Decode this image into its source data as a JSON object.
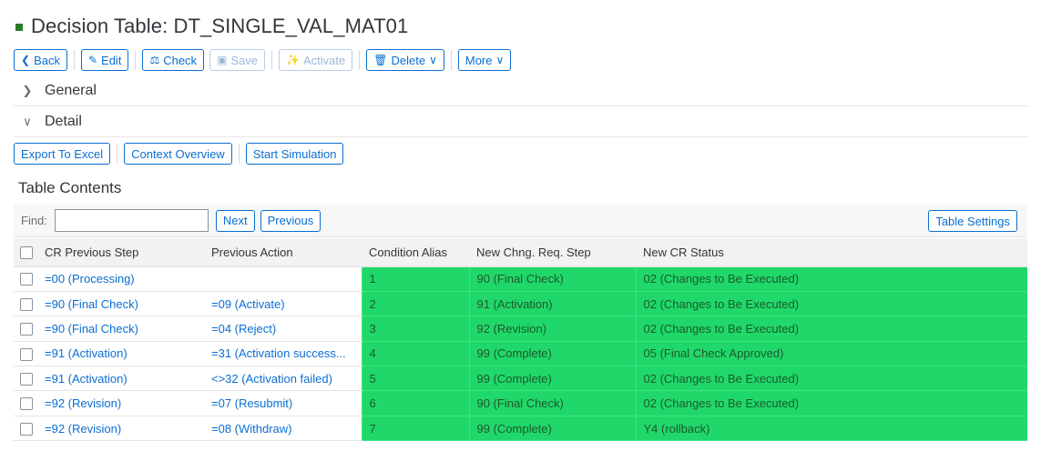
{
  "title": "Decision Table: DT_SINGLE_VAL_MAT01",
  "toolbar": {
    "back": "Back",
    "edit": "Edit",
    "check": "Check",
    "save": "Save",
    "activate": "Activate",
    "delete": "Delete",
    "more": "More"
  },
  "panels": {
    "general": "General",
    "detail": "Detail"
  },
  "actions": {
    "export": "Export To Excel",
    "context": "Context Overview",
    "simulation": "Start Simulation"
  },
  "table_title": "Table Contents",
  "find": {
    "label": "Find:",
    "value": "",
    "next": "Next",
    "previous": "Previous",
    "settings": "Table Settings"
  },
  "columns": [
    "CR Previous Step",
    "Previous Action",
    "Condition Alias",
    "New Chng. Req. Step",
    "New CR Status"
  ],
  "rows": [
    [
      "=00 (Processing)",
      "",
      "1",
      "90 (Final Check)",
      "02 (Changes to Be Executed)"
    ],
    [
      "=90 (Final Check)",
      "=09 (Activate)",
      "2",
      "91 (Activation)",
      "02 (Changes to Be Executed)"
    ],
    [
      "=90 (Final Check)",
      "=04 (Reject)",
      "3",
      "92 (Revision)",
      "02 (Changes to Be Executed)"
    ],
    [
      "=91 (Activation)",
      "=31 (Activation success...",
      "4",
      "99 (Complete)",
      "05 (Final Check Approved)"
    ],
    [
      "=91 (Activation)",
      "<>32 (Activation failed)",
      "5",
      "99 (Complete)",
      "02 (Changes to Be Executed)"
    ],
    [
      "=92 (Revision)",
      "=07 (Resubmit)",
      "6",
      "90 (Final Check)",
      "02 (Changes to Be Executed)"
    ],
    [
      "=92 (Revision)",
      "=08 (Withdraw)",
      "7",
      "99 (Complete)",
      "Y4 (rollback)"
    ]
  ],
  "colors": {
    "accent": "#0a6ed1",
    "result_cell": "#20d86a",
    "title_marker": "#2b7d2b"
  }
}
